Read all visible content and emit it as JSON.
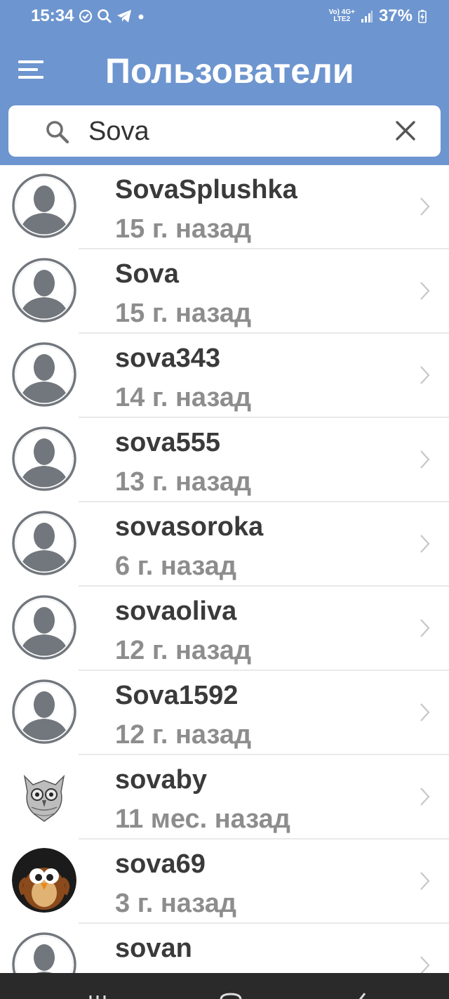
{
  "status_bar": {
    "time": "15:34",
    "network_top": "Vo) 4G+",
    "network_bottom": "LTE2",
    "battery": "37%",
    "icons": [
      "sync-icon",
      "search-icon",
      "telegram-icon",
      "dot-icon",
      "signal-icon",
      "battery-charging-icon"
    ]
  },
  "header": {
    "title": "Пользователи"
  },
  "search": {
    "value": "Sova",
    "icons": [
      "search-icon",
      "clear-icon"
    ]
  },
  "users": [
    {
      "name": "SovaSplushka",
      "last_seen": "15 г. назад",
      "avatar": "default-avatar-icon"
    },
    {
      "name": "Sova",
      "last_seen": "15 г. назад",
      "avatar": "default-avatar-icon"
    },
    {
      "name": "sova343",
      "last_seen": "14 г. назад",
      "avatar": "default-avatar-icon"
    },
    {
      "name": "sova555",
      "last_seen": "13 г. назад",
      "avatar": "default-avatar-icon"
    },
    {
      "name": "sovasoroka",
      "last_seen": "6 г. назад",
      "avatar": "default-avatar-icon"
    },
    {
      "name": "sovaoliva",
      "last_seen": "12 г. назад",
      "avatar": "default-avatar-icon"
    },
    {
      "name": "Sova1592",
      "last_seen": "12 г. назад",
      "avatar": "default-avatar-icon"
    },
    {
      "name": "sovaby",
      "last_seen": "11 мес. назад",
      "avatar": "owl-sketch-avatar"
    },
    {
      "name": "sova69",
      "last_seen": "3 г. назад",
      "avatar": "cartoon-owl-avatar"
    },
    {
      "name": "sovan",
      "last_seen": "",
      "avatar": "default-avatar-icon"
    }
  ],
  "navbar": {
    "icons": [
      "recent-apps-icon",
      "home-icon",
      "back-icon"
    ]
  },
  "colors": {
    "header": "#6d95cf",
    "avatar_placeholder": "#72777d",
    "name_text": "#3a3a3a",
    "time_text": "#8d8d8d"
  }
}
